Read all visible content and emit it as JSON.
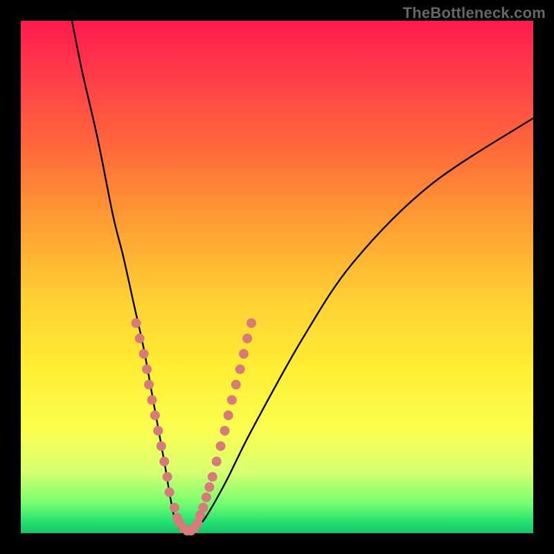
{
  "watermark": "TheBottleneck.com",
  "chart_data": {
    "type": "line",
    "title": "",
    "xlabel": "",
    "ylabel": "",
    "xlim": [
      0,
      100
    ],
    "ylim": [
      0,
      100
    ],
    "series": [
      {
        "name": "bottleneck-curve",
        "x": [
          10,
          12,
          15,
          18,
          20,
          22,
          24,
          26,
          28,
          29,
          30,
          31,
          32,
          33,
          34,
          36,
          40,
          45,
          55,
          65,
          80,
          100
        ],
        "y": [
          100,
          90,
          77,
          62,
          54,
          45,
          36,
          25,
          14,
          8,
          3,
          1,
          0,
          0,
          1,
          3,
          10,
          20,
          38,
          53,
          68,
          81
        ]
      }
    ],
    "marker_points_left": {
      "name": "markers-left",
      "x": [
        22.5,
        23.2,
        24.0,
        24.6,
        25.0,
        25.6,
        26.2,
        26.8,
        27.4,
        28.0,
        28.6,
        29.0,
        30.0,
        30.5,
        31.0,
        31.8,
        32.5
      ],
      "y": [
        41,
        38,
        35,
        32,
        29,
        26,
        23,
        20,
        17,
        14,
        11,
        8,
        5,
        3,
        2,
        1,
        0.5
      ]
    },
    "marker_points_right": {
      "name": "markers-right",
      "x": [
        33.2,
        33.8,
        34.5,
        35.0,
        35.6,
        36.2,
        36.8,
        37.4,
        38.2,
        39.0,
        39.8,
        40.5,
        41.2,
        42.0,
        42.8,
        43.5,
        44.2,
        45.0
      ],
      "y": [
        0.5,
        1,
        2,
        3.5,
        5,
        7,
        9,
        11,
        14,
        17,
        20,
        23,
        26,
        29,
        32,
        35,
        38,
        41
      ]
    },
    "marker_color": "#d97a7a",
    "curve_color": "#000000"
  }
}
